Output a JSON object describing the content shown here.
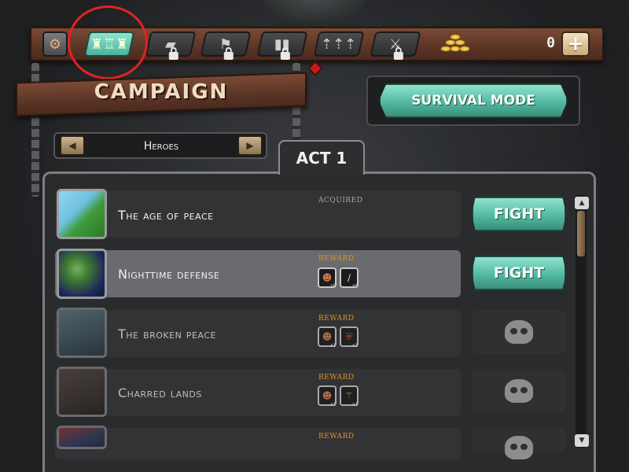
{
  "header": {
    "gold_value": "0",
    "add_gold_label": "+",
    "nav": [
      {
        "name": "settings",
        "icon": "gear-icon",
        "locked": false
      },
      {
        "name": "campaign",
        "icon": "castle-skyline-icon",
        "locked": false,
        "active": true
      },
      {
        "name": "book",
        "icon": "book-icon",
        "locked": true
      },
      {
        "name": "flag",
        "icon": "flag-icon",
        "locked": true
      },
      {
        "name": "cards",
        "icon": "cards-icon",
        "locked": true
      },
      {
        "name": "upgrades",
        "icon": "arrows-icon",
        "locked": false
      },
      {
        "name": "weapons",
        "icon": "crossed-swords-icon",
        "locked": true
      }
    ]
  },
  "campaign": {
    "title": "CAMPAIGN",
    "survival_label": "SURVIVAL MODE",
    "selector_label": "Heroes",
    "act_label": "ACT 1"
  },
  "missions": [
    {
      "title": "The age of peace",
      "tag": "ACQUIRED",
      "action": "FIGHT",
      "state": "available"
    },
    {
      "title": "Nighttime defense",
      "tag": "REWARD",
      "action": "FIGHT",
      "state": "selected",
      "rewards": [
        {
          "icon": "hero-portrait-icon",
          "count": "x6"
        },
        {
          "icon": "horn-icon",
          "count": "x6"
        }
      ]
    },
    {
      "title": "The broken peace",
      "tag": "REWARD",
      "state": "locked",
      "rewards": [
        {
          "icon": "hero-portrait-icon",
          "count": "x1"
        },
        {
          "icon": "shield-icon",
          "count": "x1"
        }
      ]
    },
    {
      "title": "Charred lands",
      "tag": "REWARD",
      "state": "locked",
      "rewards": [
        {
          "icon": "hero-portrait-icon",
          "count": "x1"
        },
        {
          "icon": "staff-icon",
          "count": "x1"
        }
      ]
    },
    {
      "title": "",
      "tag": "REWARD",
      "state": "locked"
    }
  ],
  "colors": {
    "accent_teal": "#4fb59c",
    "wood": "#5b3526",
    "reward_orange": "#e0902a",
    "highlight_red": "#e32222"
  }
}
